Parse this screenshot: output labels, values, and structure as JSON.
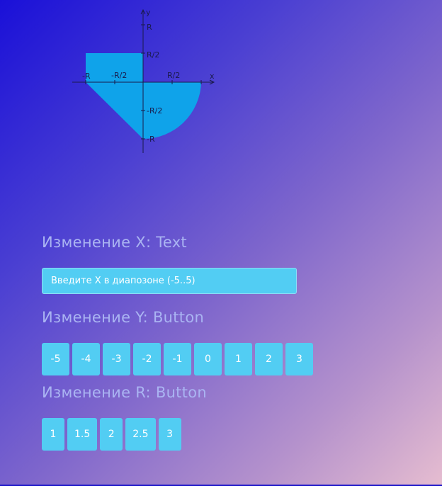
{
  "graph": {
    "fill_color": "#0fa3ea",
    "axis_labels": {
      "x": "x",
      "y": "y"
    },
    "ticks": {
      "x_neg_r": "-R",
      "x_neg_half": "-R/2",
      "x_pos_half": "R/2",
      "y_pos_r": "R",
      "y_pos_half": "R/2",
      "y_neg_half": "-R/2",
      "y_neg_r": "-R"
    }
  },
  "x_section": {
    "title": "Изменение X: Text",
    "placeholder": "Введите X в диапозоне (-5..5)"
  },
  "y_section": {
    "title": "Изменение Y: Button",
    "buttons": [
      "-5",
      "-4",
      "-3",
      "-2",
      "-1",
      "0",
      "1",
      "2",
      "3"
    ]
  },
  "r_section": {
    "title": "Изменение R: Button",
    "buttons": [
      "1",
      "1.5",
      "2",
      "2.5",
      "3"
    ]
  },
  "colors": {
    "accent": "#52cdf3",
    "title_text": "#aab4f2"
  }
}
